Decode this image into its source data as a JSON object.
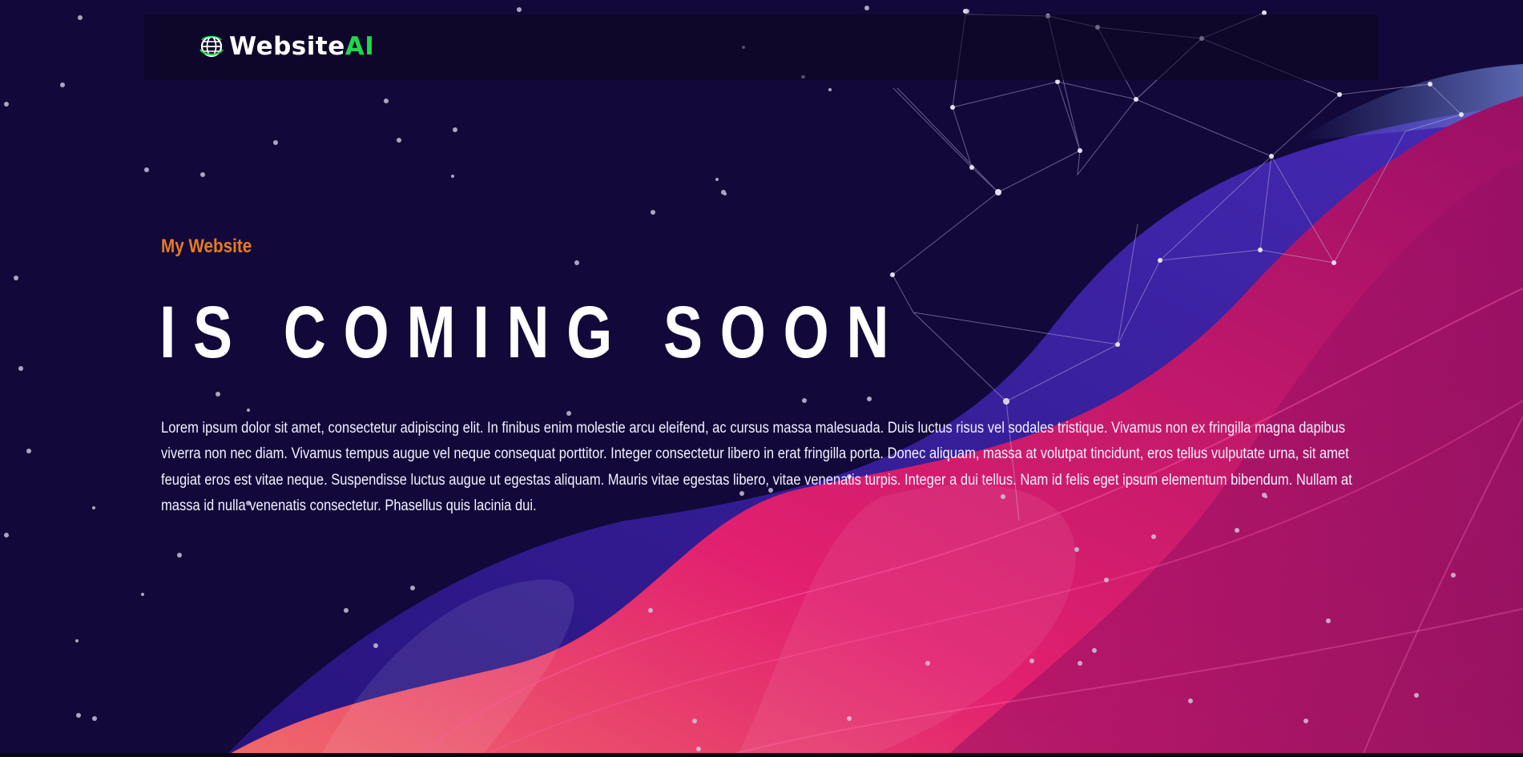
{
  "brand": {
    "name": "Website",
    "accent": "AI",
    "accent_color": "#1fd84a"
  },
  "hero": {
    "subtitle": "My Website",
    "headline": "IS COMING SOON",
    "description": "Lorem ipsum dolor sit amet, consectetur adipiscing elit. In finibus enim molestie arcu eleifend, ac cursus massa malesuada. Duis luctus risus vel sodales tristique. Vivamus non ex fringilla magna dapibus viverra non nec diam. Vivamus tempus augue vel neque consequat porttitor. Integer consectetur libero in erat fringilla porta. Donec aliquam, massa at volutpat tincidunt, eros tellus vulputate urna, sit amet feugiat eros est vitae neque. Suspendisse luctus augue ut egestas aliquam. Mauris vitae egestas libero, vitae venenatis turpis. Integer a dui tellus. Nam id felis eget ipsum elementum bibendum. Nullam at massa id nulla venenatis consectetur. Phasellus quis lacinia dui."
  },
  "colors": {
    "background": "#12093a",
    "subtitle": "#ea7a1f",
    "headline": "#ffffff",
    "wave_pink": "#e0186f",
    "wave_purple": "#3a1c9e"
  },
  "icons": {
    "logo": "globe-icon"
  }
}
